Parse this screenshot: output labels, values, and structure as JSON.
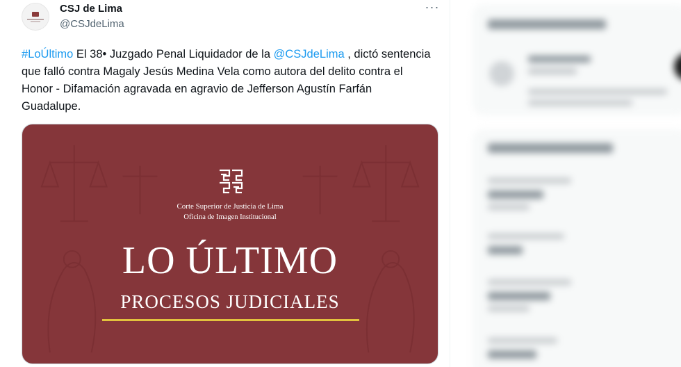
{
  "account": {
    "display_name": "CSJ de Lima",
    "handle": "@CSJdeLima"
  },
  "menu": {
    "more_label": "···"
  },
  "tweet": {
    "hashtag": "#LoÚltimo",
    "part1": " El 38• Juzgado Penal Liquidador de la ",
    "mention": "@CSJdeLima",
    "part2": " , dictó sentencia que falló contra Magaly Jesús Medina Vela como autora del delito contra el Honor - Difamación agravada en agravio de Jefferson Agustín Farfán Guadalupe."
  },
  "media": {
    "org_line1": "Corte Superior de Justicia de Lima",
    "org_line2": "Oficina de Imagen Institucional",
    "headline": "LO ÚLTIMO",
    "subhead": "PROCESOS JUDICIALES",
    "background_color": "#85363a",
    "accent_color": "#e2c23d",
    "icon": "court-seal-icon"
  },
  "colors": {
    "link": "#1d9bf0",
    "text": "#0f1419",
    "muted": "#536471"
  }
}
